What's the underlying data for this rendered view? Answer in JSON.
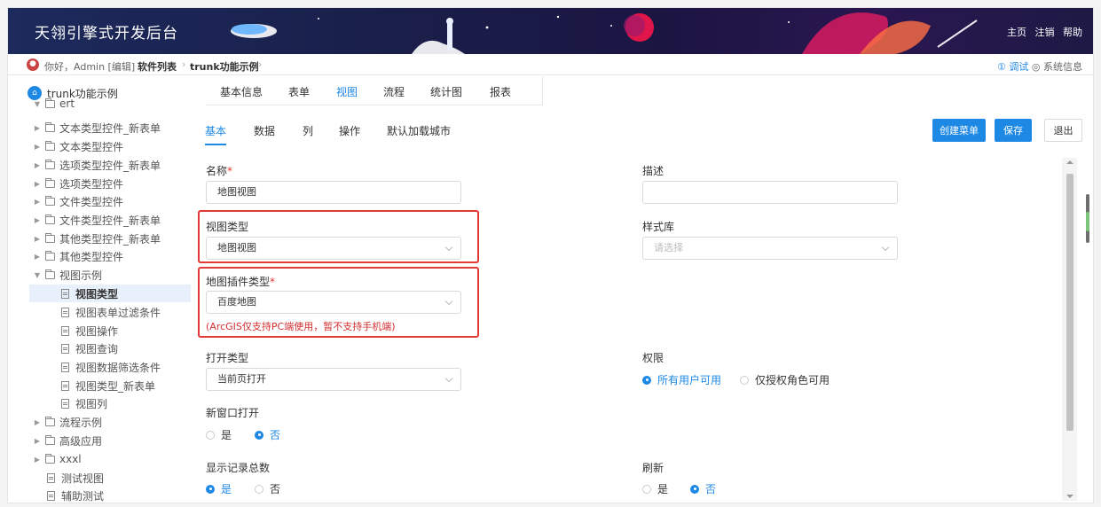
{
  "header": {
    "brand": "天翎引擎式开发后台",
    "links": [
      "主页",
      "注销",
      "帮助"
    ]
  },
  "crumbbar": {
    "greeting": "你好，Admin [编辑]",
    "crumbs": [
      "软件列表",
      "trunk功能示例"
    ],
    "debug": "① 调试",
    "sysinfo": "◎ 系统信息"
  },
  "sidebar": {
    "root": "trunk功能示例",
    "items": [
      {
        "label": "ert",
        "type": "folder",
        "expanded": true
      },
      {
        "label": "文本类型控件_新表单",
        "type": "folder"
      },
      {
        "label": "文本类型控件",
        "type": "folder"
      },
      {
        "label": "选项类型控件_新表单",
        "type": "folder"
      },
      {
        "label": "选项类型控件",
        "type": "folder"
      },
      {
        "label": "文件类型控件",
        "type": "folder"
      },
      {
        "label": "文件类型控件_新表单",
        "type": "folder"
      },
      {
        "label": "其他类型控件_新表单",
        "type": "folder"
      },
      {
        "label": "其他类型控件",
        "type": "folder"
      },
      {
        "label": "视图示例",
        "type": "folder",
        "expanded": true
      },
      {
        "label": "视图类型",
        "type": "doc",
        "selected": true
      },
      {
        "label": "视图表单过滤条件",
        "type": "doc"
      },
      {
        "label": "视图操作",
        "type": "doc"
      },
      {
        "label": "视图查询",
        "type": "doc"
      },
      {
        "label": "视图数据筛选条件",
        "type": "doc"
      },
      {
        "label": "视图类型_新表单",
        "type": "doc"
      },
      {
        "label": "视图列",
        "type": "doc"
      },
      {
        "label": "流程示例",
        "type": "folder"
      },
      {
        "label": "高级应用",
        "type": "folder"
      },
      {
        "label": "xxxl",
        "type": "folder"
      },
      {
        "label": "测试视图",
        "type": "doc"
      },
      {
        "label": "辅助测试",
        "type": "doc"
      }
    ]
  },
  "tabs": [
    "基本信息",
    "表单",
    "视图",
    "流程",
    "统计图",
    "报表"
  ],
  "active_tab": "视图",
  "subtabs": [
    "基本",
    "数据",
    "列",
    "操作",
    "默认加载城市"
  ],
  "active_subtab": "基本",
  "buttons": {
    "create_menu": "创建菜单",
    "save": "保存",
    "exit": "退出"
  },
  "form": {
    "name_label": "名称",
    "name_value": "地图视图",
    "desc_label": "描述",
    "desc_value": "",
    "view_type_label": "视图类型",
    "view_type_value": "地图视图",
    "style_label": "样式库",
    "style_placeholder": "请选择",
    "map_plugin_label": "地图插件类型",
    "map_plugin_value": "百度地图",
    "map_hint": "(ArcGIS仅支持PC端使用，暂不支持手机端)",
    "open_type_label": "打开类型",
    "open_type_value": "当前页打开",
    "permission_label": "权限",
    "permission_options": [
      "所有用户可用",
      "仅授权角色可用"
    ],
    "new_window_label": "新窗口打开",
    "new_window_options": [
      "是",
      "否"
    ],
    "show_total_label": "显示记录总数",
    "show_total_options": [
      "是",
      "否"
    ],
    "refresh_label": "刷新",
    "refresh_options": [
      "是",
      "否"
    ],
    "required_mark": "*"
  },
  "colors": {
    "accent": "#1e88e5",
    "highlight": "#e53935",
    "header_bg": "#1c1f4d"
  }
}
